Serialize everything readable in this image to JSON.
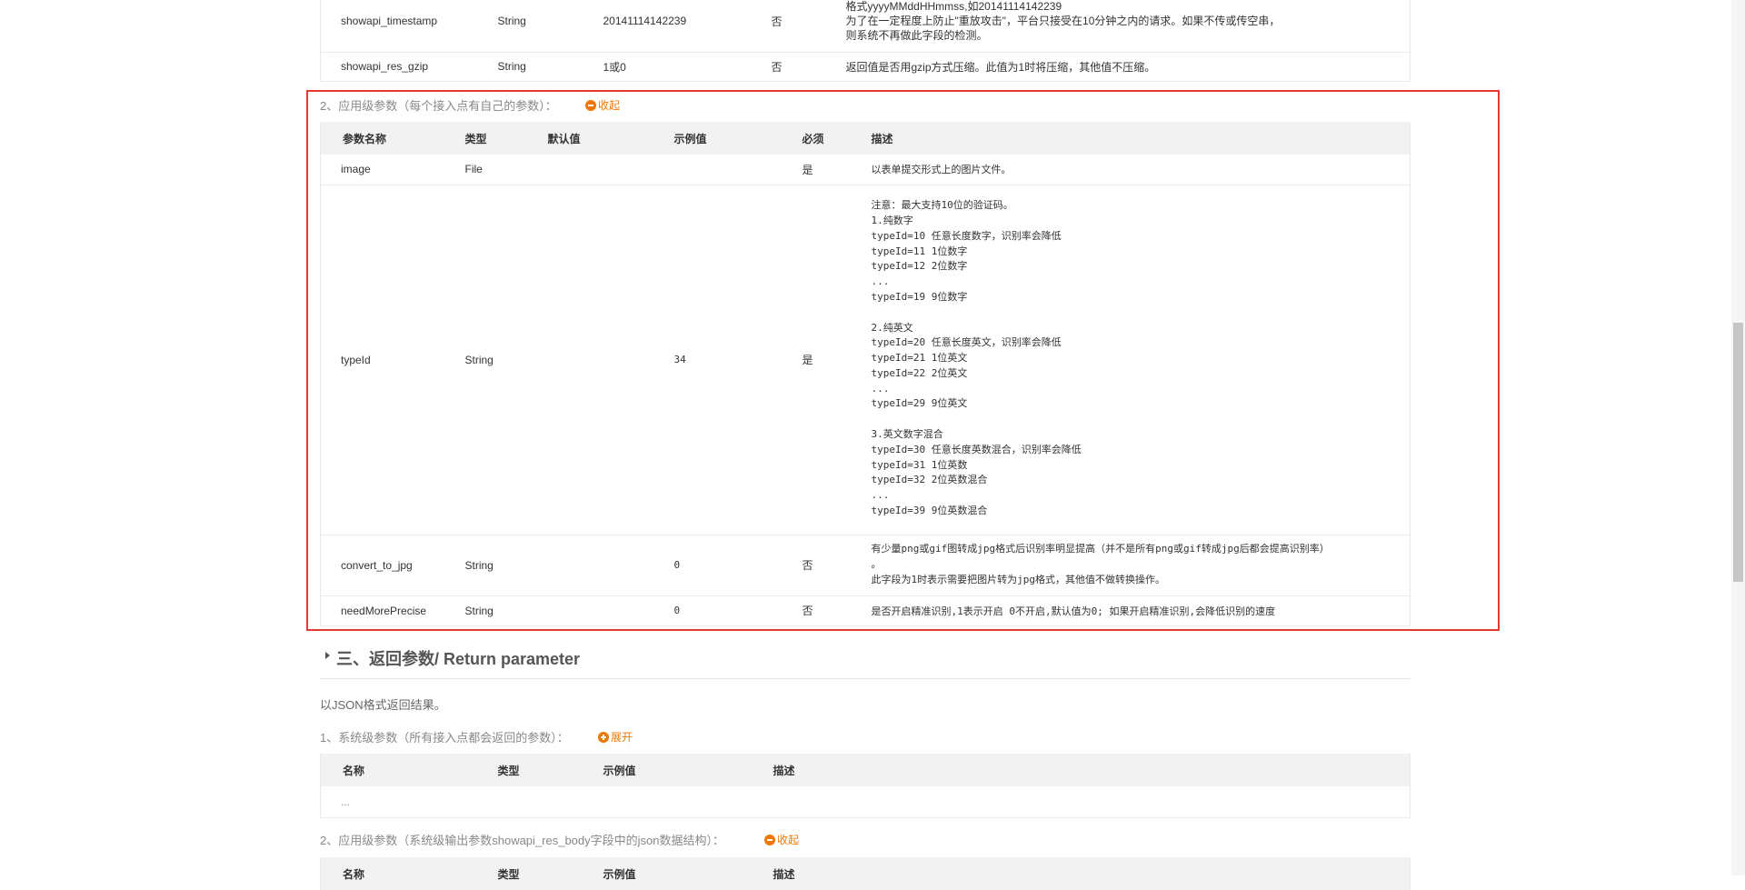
{
  "system_params_top": [
    {
      "name": "showapi_timestamp",
      "type": "String",
      "example": "20141114142239",
      "required": "否",
      "desc": "格式yyyyMMddHHmmss,如20141114142239\n为了在一定程度上防止\"重放攻击\"，平台只接受在10分钟之内的请求。如果不传或传空串，\n则系统不再做此字段的检测。"
    },
    {
      "name": "showapi_res_gzip",
      "type": "String",
      "example": "1或0",
      "required": "否",
      "desc": "返回值是否用gzip方式压缩。此值为1时将压缩，其他值不压缩。"
    }
  ],
  "app_params": {
    "label": "2、应用级参数（每个接入点有自己的参数）：",
    "toggle": "收起",
    "headers": {
      "name": "参数名称",
      "type": "类型",
      "default": "默认值",
      "example": "示例值",
      "required": "必须",
      "desc": "描述"
    },
    "rows": [
      {
        "name": "image",
        "type": "File",
        "default": "",
        "example": "",
        "required": "是",
        "desc": "以表单提交形式上的图片文件。"
      },
      {
        "name": "typeId",
        "type": "String",
        "default": "",
        "example": "34",
        "required": "是",
        "desc": "注意：最大支持10位的验证码。\n1.纯数字\ntypeId=10 任意长度数字，识别率会降低\ntypeId=11 1位数字\ntypeId=12 2位数字\n...\ntypeId=19 9位数字\n\n2.纯英文\ntypeId=20 任意长度英文，识别率会降低\ntypeId=21 1位英文\ntypeId=22 2位英文\n...\ntypeId=29 9位英文\n\n3.英文数字混合\ntypeId=30 任意长度英数混合，识别率会降低\ntypeId=31 1位英数\ntypeId=32 2位英数混合\n...\ntypeId=39 9位英数混合"
      },
      {
        "name": "convert_to_jpg",
        "type": "String",
        "default": "",
        "example": "0",
        "required": "否",
        "desc": "有少量png或gif图转成jpg格式后识别率明显提高（并不是所有png或gif转成jpg后都会提高识别率）\n。\n此字段为1时表示需要把图片转为jpg格式，其他值不做转换操作。"
      },
      {
        "name": "needMorePrecise",
        "type": "String",
        "default": "",
        "example": "0",
        "required": "否",
        "desc": "是否开启精准识别,1表示开启  0不开启,默认值为0; 如果开启精准识别,会降低识别的速度"
      }
    ]
  },
  "return_section": {
    "title": "三、返回参数/ Return parameter",
    "intro": "以JSON格式返回结果。",
    "sys_label": "1、系统级参数（所有接入点都会返回的参数）：",
    "sys_toggle": "展开",
    "sys_headers": {
      "name": "名称",
      "type": "类型",
      "example": "示例值",
      "desc": "描述"
    },
    "sys_ellipsis": "...",
    "app_label": "2、应用级参数（系统级输出参数showapi_res_body字段中的json数据结构）：",
    "app_toggle": "收起",
    "app_headers": {
      "name": "名称",
      "type": "类型",
      "example": "示例值",
      "desc": "描述"
    }
  }
}
